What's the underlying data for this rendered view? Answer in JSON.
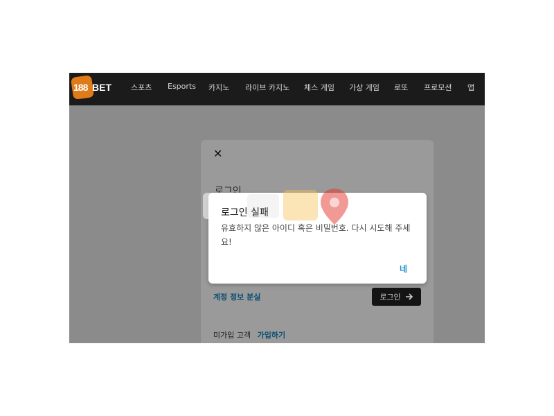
{
  "nav": {
    "logo_number": "188",
    "logo_text": "BET",
    "items": [
      "스포츠",
      "Esports",
      "카지노",
      "라이브 카지노",
      "체스 게임",
      "가상 게임",
      "로또",
      "프로모션",
      "앱"
    ]
  },
  "login_card": {
    "title": "로그인",
    "forgot_label": "계정 정보 분실",
    "login_button_label": "로그인",
    "signup_prompt": "미가입 고객",
    "signup_link": "가입하기"
  },
  "dialog": {
    "title": "로그인 실패",
    "message": "유효하지 않은 아이디 혹은 비밀번호. 다시 시도해 주세요!",
    "ok_label": "네"
  },
  "colors": {
    "nav_bg": "#1b1b1b",
    "overlay": "#8b8b8b",
    "logo_orange": "#e07b1a",
    "link_blue": "#0d4f73",
    "ok_blue": "#1a8fd0"
  }
}
